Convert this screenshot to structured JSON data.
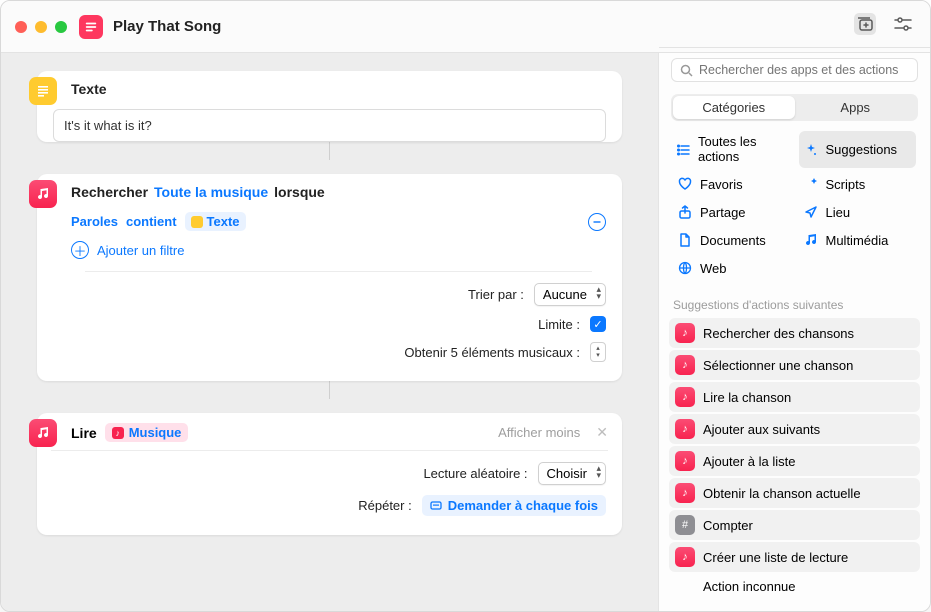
{
  "window": {
    "title": "Play That Song"
  },
  "card1": {
    "title": "Texte",
    "value": "It's it what is it?"
  },
  "card2": {
    "search": "Rechercher",
    "scope": "Toute la musique",
    "when": "lorsque",
    "field": "Paroles",
    "op": "contient",
    "varchip": "Texte",
    "addFilter": "Ajouter un filtre",
    "sortLabel": "Trier par :",
    "sortValue": "Aucune",
    "limitLabel": "Limite :",
    "getLabel": "Obtenir 5 éléments musicaux :"
  },
  "card3": {
    "play": "Lire",
    "music": "Musique",
    "showLess": "Afficher moins",
    "shuffleLabel": "Lecture aléatoire :",
    "shuffleValue": "Choisir",
    "repeatLabel": "Répéter :",
    "repeatValue": "Demander à chaque fois"
  },
  "sidebar": {
    "searchPlaceholder": "Rechercher des apps et des actions",
    "segCategories": "Catégories",
    "segApps": "Apps",
    "cats": {
      "all": "Toutes les actions",
      "sugg": "Suggestions",
      "fav": "Favoris",
      "scripts": "Scripts",
      "share": "Partage",
      "loc": "Lieu",
      "docs": "Documents",
      "media": "Multimédia",
      "web": "Web"
    },
    "suggHeader": "Suggestions d'actions suivantes",
    "suggestions": [
      "Rechercher des chansons",
      "Sélectionner une chanson",
      "Lire la chanson",
      "Ajouter aux suivants",
      "Ajouter à la liste",
      "Obtenir la chanson actuelle",
      "Compter",
      "Créer une liste de lecture"
    ],
    "unknown": "Action inconnue"
  }
}
